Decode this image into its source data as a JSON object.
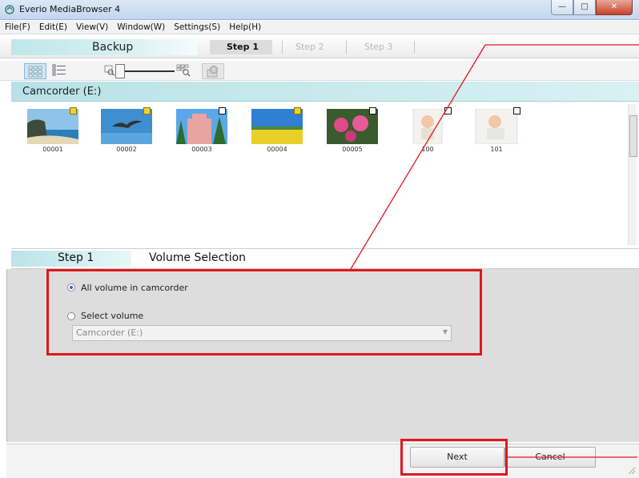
{
  "window": {
    "title": "Everio MediaBrowser 4",
    "controls": [
      "minimize",
      "maximize",
      "close"
    ]
  },
  "menu": [
    "File(F)",
    "Edit(E)",
    "View(V)",
    "Window(W)",
    "Settings(S)",
    "Help(H)"
  ],
  "stepbar": {
    "mode": "Backup",
    "steps": [
      "Step 1",
      "Step 2",
      "Step 3"
    ],
    "active_step": "Step 1"
  },
  "toolbar": {
    "icons": [
      "grid-view-icon",
      "list-view-icon",
      "zoom-out-icon",
      "zoom-in-icon",
      "info-icon"
    ]
  },
  "device": {
    "label": "Camcorder (E:)"
  },
  "thumbnails": [
    {
      "label": "00001",
      "marker": "yellow",
      "scene": "coast"
    },
    {
      "label": "00002",
      "marker": "yellow",
      "scene": "bird"
    },
    {
      "label": "00003",
      "marker": "white",
      "scene": "building"
    },
    {
      "label": "00004",
      "marker": "yellow",
      "scene": "field"
    },
    {
      "label": "00005",
      "marker": "white",
      "scene": "flowers"
    },
    {
      "label": "100",
      "marker": "white",
      "scene": "baby"
    },
    {
      "label": "101",
      "marker": "white",
      "scene": "baby"
    }
  ],
  "step_header": {
    "step": "Step 1",
    "title": "Volume Selection"
  },
  "options": {
    "all_volume": {
      "label": "All volume in camcorder",
      "checked": true
    },
    "select_volume": {
      "label": "Select volume",
      "checked": false
    },
    "volume_dropdown": {
      "value": "Camcorder (E:)",
      "disabled": true
    }
  },
  "footer": {
    "next_label": "Next",
    "cancel_label": "Cancel"
  },
  "colors": {
    "annotation": "#e0171f",
    "teal_accent": "#b7e2e7",
    "panel_bg": "#dddddd"
  }
}
